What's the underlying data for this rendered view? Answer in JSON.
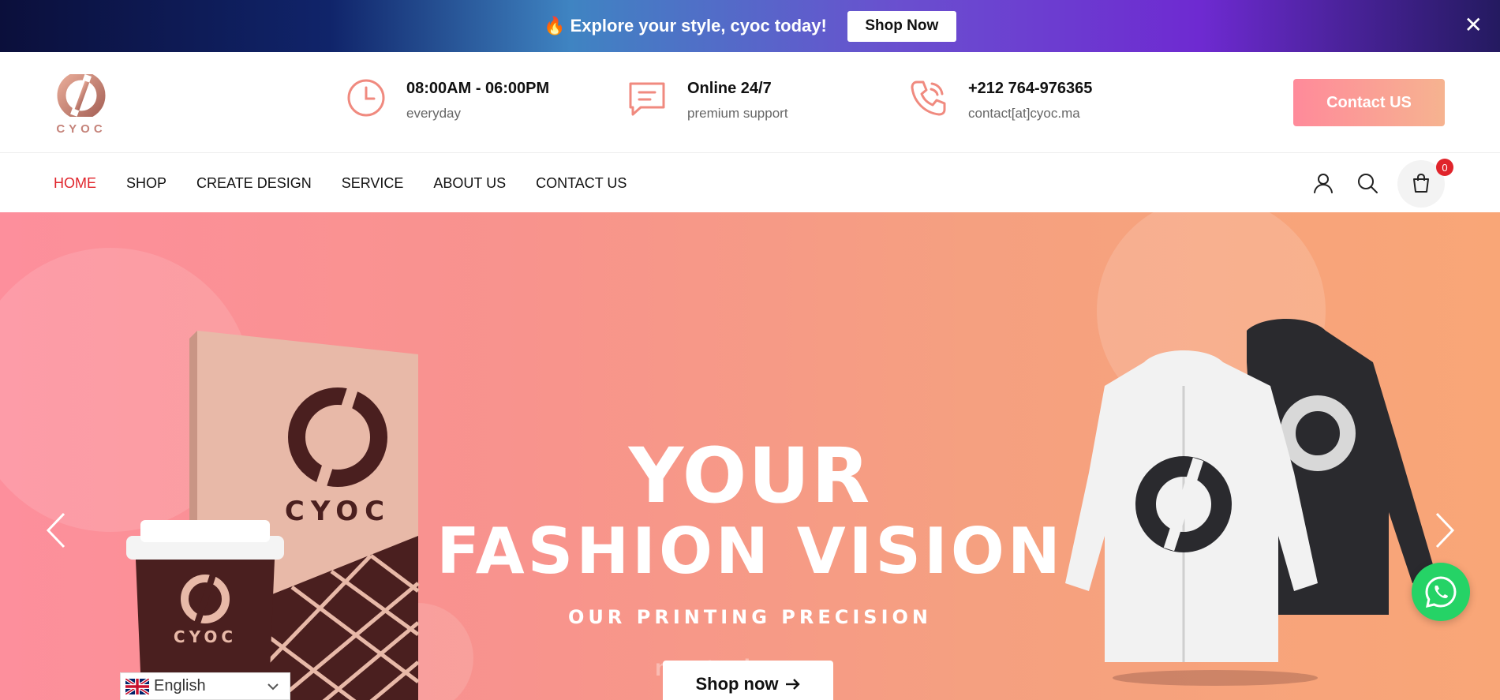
{
  "promo": {
    "icon": "flame-icon",
    "text": "Explore your style, cyoc today!",
    "button": "Shop Now",
    "close_icon": "close-icon"
  },
  "header": {
    "logo_text": "CYOC",
    "hours": {
      "title": "08:00AM - 06:00PM",
      "sub": "everyday",
      "icon": "clock-icon"
    },
    "online": {
      "title": "Online 24/7",
      "sub": "premium support",
      "icon": "chat-icon"
    },
    "phone": {
      "title": "+212 764-976365",
      "sub": "contact[at]cyoc.ma",
      "icon": "phone-icon"
    },
    "contact_button": "Contact US"
  },
  "nav": {
    "items": [
      {
        "label": "HOME",
        "active": true
      },
      {
        "label": "SHOP"
      },
      {
        "label": "CREATE DESIGN"
      },
      {
        "label": "SERVICE"
      },
      {
        "label": "ABOUT US"
      },
      {
        "label": "CONTACT US"
      }
    ],
    "cart_count": "0"
  },
  "hero": {
    "title_line1": "YOUR",
    "title_line2": "FASHION VISION",
    "subtitle": "OUR PRINTING PRECISION",
    "button": "Shop now",
    "book_brand": "CYOC",
    "cup_brand": "CYOC"
  },
  "language": {
    "selected": "English"
  },
  "watermark": "mostaql.com",
  "colors": {
    "accent": "#e0242b",
    "brand": "#c5837a",
    "whatsapp": "#25d366"
  }
}
